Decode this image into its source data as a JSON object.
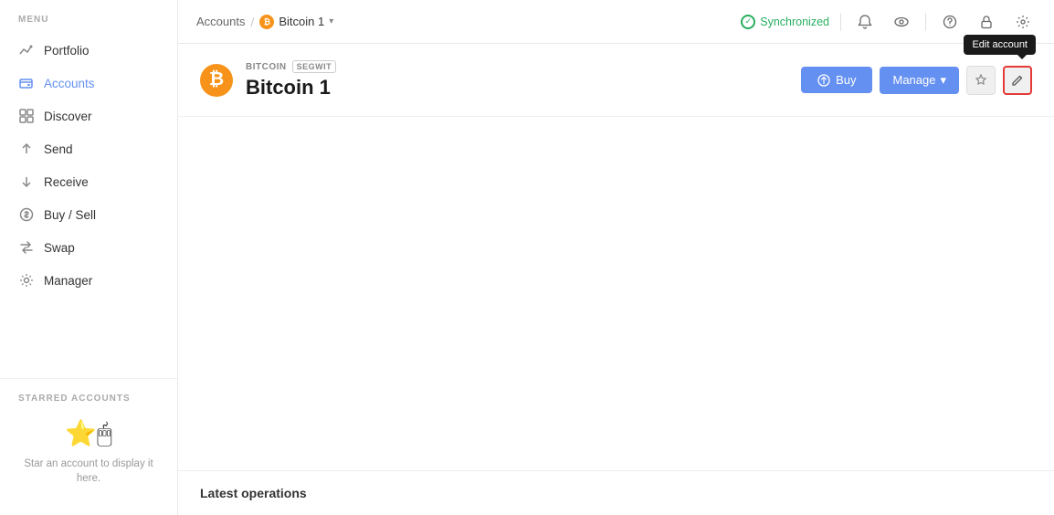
{
  "sidebar": {
    "menu_label": "MENU",
    "items": [
      {
        "id": "portfolio",
        "label": "Portfolio",
        "icon": "chart"
      },
      {
        "id": "accounts",
        "label": "Accounts",
        "icon": "wallet"
      },
      {
        "id": "discover",
        "label": "Discover",
        "icon": "grid"
      },
      {
        "id": "send",
        "label": "Send",
        "icon": "arrow-up"
      },
      {
        "id": "receive",
        "label": "Receive",
        "icon": "arrow-down"
      },
      {
        "id": "buy-sell",
        "label": "Buy / Sell",
        "icon": "dollar"
      },
      {
        "id": "swap",
        "label": "Swap",
        "icon": "swap"
      },
      {
        "id": "manager",
        "label": "Manager",
        "icon": "settings"
      }
    ],
    "starred_label": "STARRED ACCOUNTS",
    "starred_empty_text": "Star an account to display it here."
  },
  "topbar": {
    "breadcrumb_accounts": "Accounts",
    "breadcrumb_separator": "/",
    "bitcoin_account": "Bitcoin 1",
    "sync_label": "Synchronized",
    "icons": {
      "bell": "🔔",
      "eye": "👁",
      "help": "?",
      "lock": "🔒",
      "settings": "⚙"
    }
  },
  "account": {
    "coin_label": "BITCOIN",
    "badge_label": "SEGWIT",
    "name": "Bitcoin 1",
    "buy_label": "Buy",
    "manage_label": "Manage",
    "tooltip_label": "Edit account"
  },
  "operations": {
    "title": "Latest operations"
  }
}
